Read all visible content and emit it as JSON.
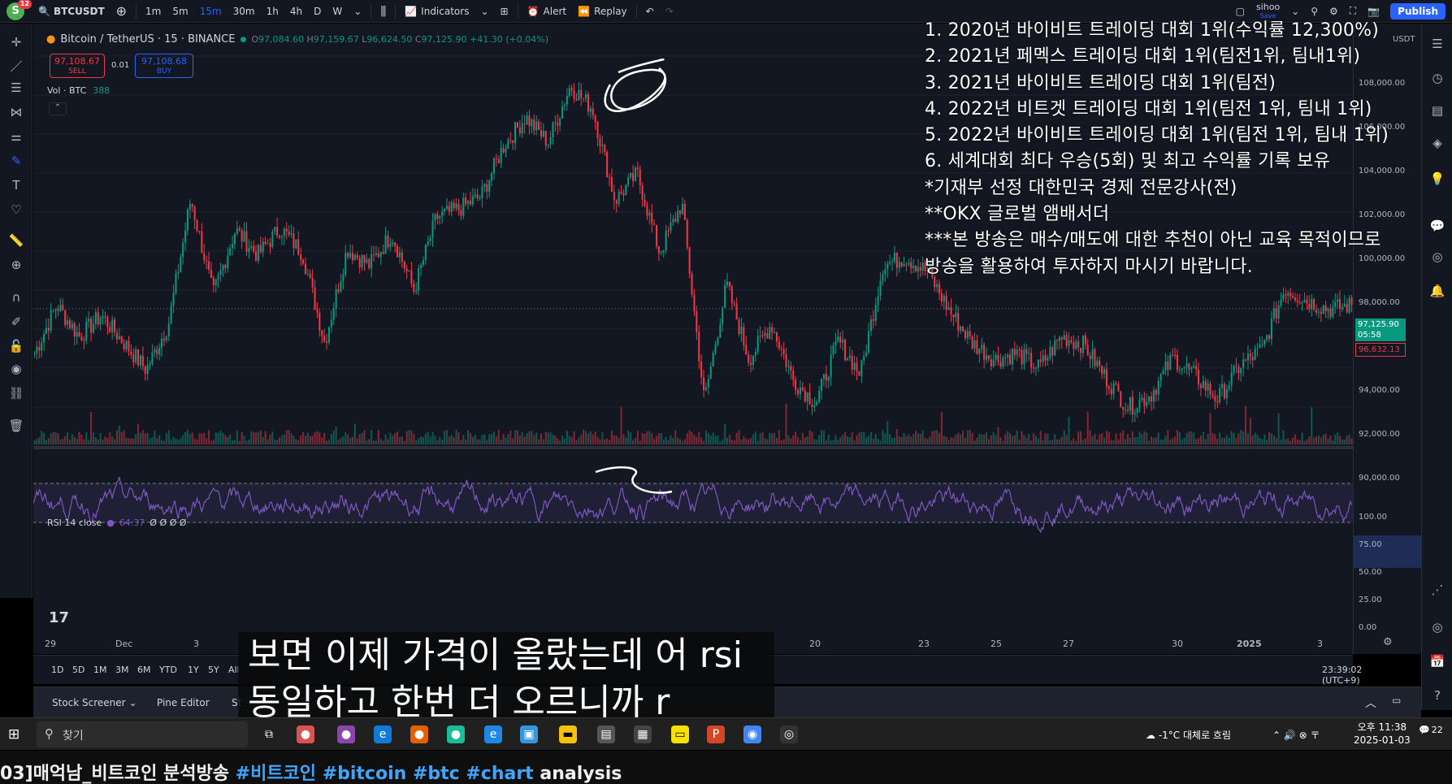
{
  "topbar": {
    "avatar_letter": "S",
    "avatar_badge": "12",
    "symbol": "BTCUSDT",
    "intervals": [
      "1m",
      "5m",
      "15m",
      "30m",
      "1h",
      "4h",
      "D",
      "W"
    ],
    "active_interval": "15m",
    "indicators_label": "Indicators",
    "alert_label": "Alert",
    "replay_label": "Replay",
    "user_name": "sihoo",
    "user_sub": "Save",
    "publish_label": "Publish"
  },
  "legend": {
    "title": "Bitcoin / TetherUS · 15 · BINANCE",
    "open": "97,084.60",
    "high": "97,159.67",
    "low": "96,624.50",
    "close": "97,125.90",
    "change": "+41.30 (+0.04%)"
  },
  "trade": {
    "sell_price": "97,108.67",
    "sell_label": "SELL",
    "spread": "0.01",
    "buy_price": "97,108.68",
    "buy_label": "BUY"
  },
  "volume": {
    "label": "Vol · BTC",
    "value": "388"
  },
  "rsi": {
    "label": "RSI 14 close",
    "value": "64.37",
    "extra": "Ø Ø Ø Ø"
  },
  "price_scale": {
    "currency": "USDT",
    "labels": [
      "108,000.00",
      "106,000.00",
      "104,000.00",
      "102,000.00",
      "100,000.00",
      "98,000.00",
      "94,000.00",
      "92,000.00",
      "90,000.00"
    ],
    "current_price": "97,125.90",
    "countdown": "05:58",
    "ref_price": "96,632.13",
    "rsi_labels": [
      "100.00",
      "75.00",
      "50.00",
      "25.00",
      "0.00"
    ]
  },
  "chart_data": {
    "type": "candlestick",
    "x_tick_labels": [
      "29",
      "Dec",
      "3",
      "",
      "",
      "",
      "",
      "20",
      "23",
      "25",
      "27",
      "30",
      "2025",
      "3"
    ],
    "ylim": [
      89000,
      110000
    ],
    "series": [
      {
        "values": [
          95000,
          97300,
          95800,
          96800,
          95500,
          94200,
          96400,
          102400,
          97800,
          100900,
          99700,
          101000,
          99800,
          95500,
          100000,
          99200,
          100700,
          98000,
          101500,
          101900,
          102500,
          104900,
          106300,
          105100,
          107800,
          106700,
          102300,
          103600,
          99800,
          102200,
          92700,
          98300,
          94700,
          96400,
          93700,
          92600,
          95600,
          94000,
          99200,
          99600,
          98900,
          97000,
          95500,
          94700,
          95000,
          94300,
          95800,
          95400,
          93800,
          92400,
          93000,
          94800,
          93900,
          92800,
          94400,
          95200,
          98100,
          97500,
          97100,
          97300
        ]
      }
    ],
    "rsi_ylim": [
      0,
      100
    ],
    "rsi_levels": [
      70,
      30
    ]
  },
  "overlay_text": [
    "1. 2020년 바이비트 트레이딩 대회 1위(수익률 12,300%)",
    "2. 2021년 페멕스 트레이딩 대회 1위(팀전1위, 팀내1위)",
    "3. 2021년 바이비트 트레이딩 대회 1위(팀전)",
    "4. 2022년 비트겟 트레이딩 대회 1위(팀전 1위, 팀내 1위)",
    "5. 2022년 바이비트 트레이딩 대회 1위(팀전 1위, 팀내 1위)",
    "6. 세계대회 최다 우승(5회) 및 최고 수익률 기록 보유",
    "*기재부 선정 대한민국 경제 전문강사(전)",
    "**OKX 글로벌 앰배서더",
    "***본 방송은 매수/매도에 대한 추천이 아닌 교육 목적이므로",
    " 방송을 활용하여 투자하지 마시기 바랍니다."
  ],
  "ranges": [
    "1D",
    "5D",
    "1M",
    "3M",
    "6M",
    "YTD",
    "1Y",
    "5Y",
    "All"
  ],
  "clock": "23:39:02 (UTC+9)",
  "panels": [
    "Stock Screener",
    "Pine Editor",
    "St"
  ],
  "subtitles": [
    "보면 이제 가격이 올랐는데 어 rsi",
    "동일하고 한번 더 오르니까 r"
  ],
  "taskbar": {
    "search_placeholder": "찾기",
    "weather": "-1°C  대체로 흐림",
    "time": "오후 11:38",
    "date": "2025-01-03",
    "notif_count": "22"
  },
  "yt_title": {
    "prefix": "03]매억남_비트코인 분석방송 ",
    "tags": "#비트코인 #bitcoin #btc #chart",
    "suffix": " analysis"
  },
  "colors": {
    "up": "#089981",
    "down": "#f23645",
    "rsi": "#7e57c2",
    "accent": "#2962ff"
  }
}
